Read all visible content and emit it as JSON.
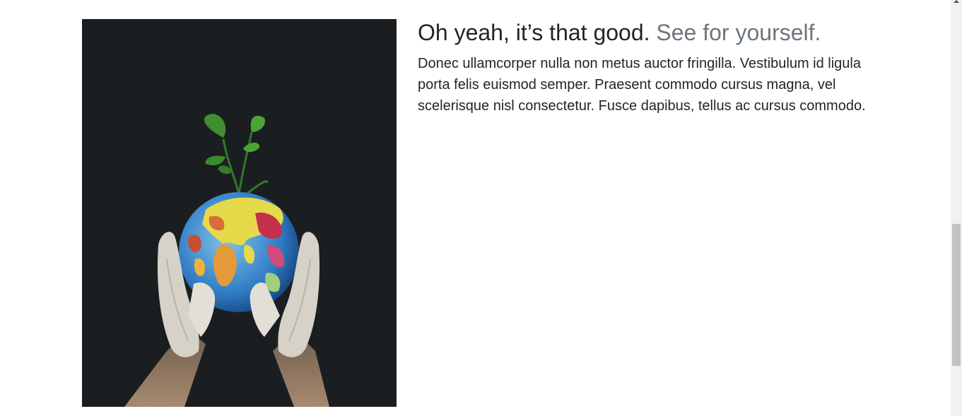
{
  "feature": {
    "heading_main": "Oh yeah, it’s that good.",
    "heading_muted": "See for yourself.",
    "body": "Donec ullamcorper nulla non metus auctor fringilla. Vestibulum id ligula porta felis euismod semper. Praesent commodo cursus magna, vel scelerisque nisl consectetur. Fusce dapibus, tellus ac cursus commodo.",
    "image": {
      "subject": "gloved-hands-holding-globe-with-plant",
      "background_color": "#1b1e20"
    }
  },
  "colors": {
    "text": "#212529",
    "muted": "#6c757d",
    "background": "#ffffff"
  }
}
